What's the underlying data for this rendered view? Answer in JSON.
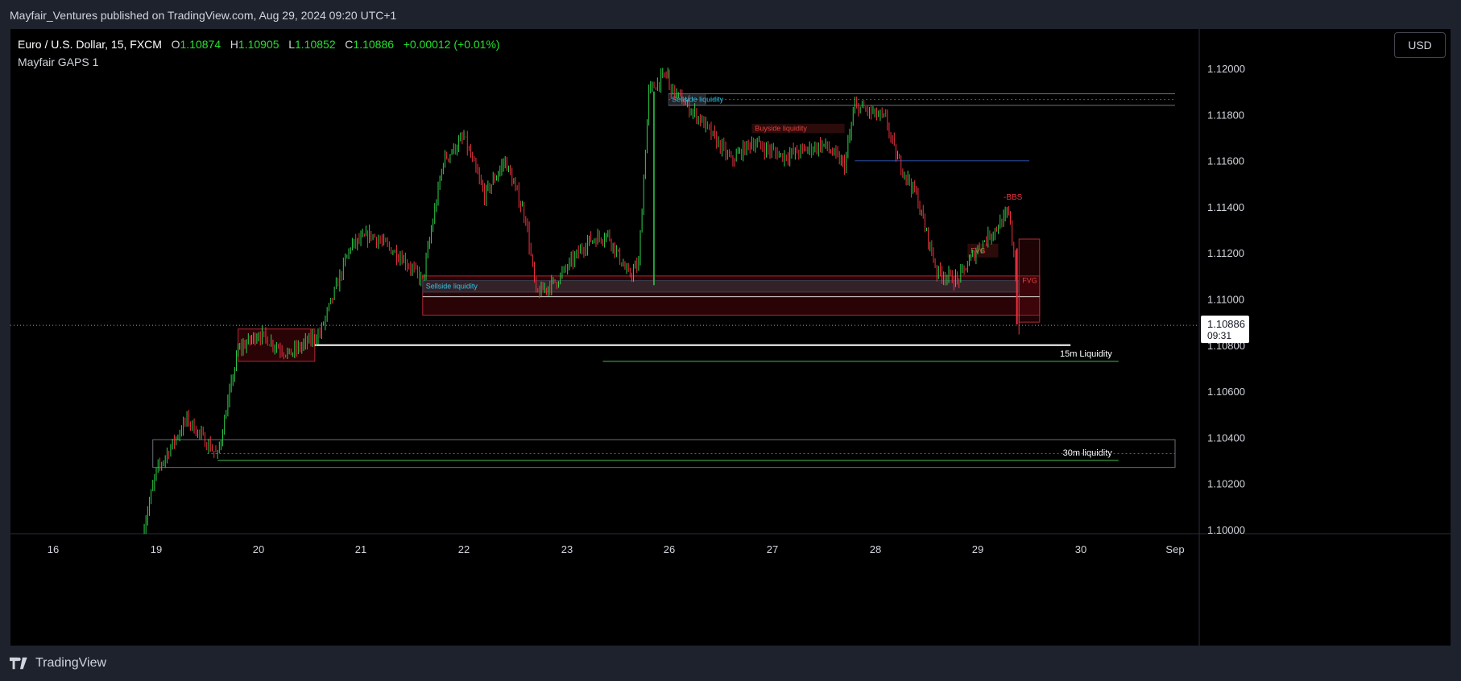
{
  "header": {
    "publisher_line": "Mayfair_Ventures published on TradingView.com, Aug 29, 2024 09:20 UTC+1"
  },
  "legend": {
    "symbol": "Euro / U.S. Dollar, 15, FXCM",
    "o_label": "O",
    "o_value": "1.10874",
    "h_label": "H",
    "h_value": "1.10905",
    "l_label": "L",
    "l_value": "1.10852",
    "c_label": "C",
    "c_value": "1.10886",
    "change": "+0.00012 (+0.01%)",
    "indicator": "Mayfair GAPS 1"
  },
  "currency_button": "USD",
  "footer": {
    "brand": "TradingView"
  },
  "colors": {
    "bull": "#26a69a",
    "bull_bright": "#2fd04a",
    "bear": "#ef5350",
    "zone_fill": "#2a0a0d",
    "zone_border": "#b22833",
    "sellside_text": "#2ec4e6",
    "buyside_text": "#e0443c",
    "liquidity_line": "#2e7d32",
    "white_line": "#ffffff"
  },
  "chart_data": {
    "type": "candlestick",
    "symbol": "EURUSD",
    "timeframe": "15",
    "ylim": [
      1.0995,
      1.121
    ],
    "y_ticks": [
      "1.12000",
      "1.11800",
      "1.11600",
      "1.11400",
      "1.11200",
      "1.11000",
      "1.10800",
      "1.10600",
      "1.10400",
      "1.10200",
      "1.10000"
    ],
    "x_ticks": [
      "16",
      "19",
      "20",
      "21",
      "22",
      "23",
      "26",
      "27",
      "28",
      "29",
      "30",
      "Sep"
    ],
    "last_price": "1.10886",
    "countdown": "09:31",
    "anchors": [
      {
        "day": "18.6",
        "price": 1.0999
      },
      {
        "day": "19.0",
        "price": 1.1025
      },
      {
        "day": "19.3",
        "price": 1.1048
      },
      {
        "day": "19.6",
        "price": 1.1032
      },
      {
        "day": "19.8",
        "price": 1.1078
      },
      {
        "day": "20.0",
        "price": 1.1085
      },
      {
        "day": "20.3",
        "price": 1.1076
      },
      {
        "day": "20.6",
        "price": 1.1085
      },
      {
        "day": "20.9",
        "price": 1.1123
      },
      {
        "day": "21.1",
        "price": 1.1128
      },
      {
        "day": "21.4",
        "price": 1.1118
      },
      {
        "day": "21.6",
        "price": 1.1108
      },
      {
        "day": "21.8",
        "price": 1.116
      },
      {
        "day": "22.0",
        "price": 1.117
      },
      {
        "day": "22.2",
        "price": 1.1145
      },
      {
        "day": "22.4",
        "price": 1.116
      },
      {
        "day": "22.6",
        "price": 1.1135
      },
      {
        "day": "22.7",
        "price": 1.1102
      },
      {
        "day": "22.9",
        "price": 1.1108
      },
      {
        "day": "23.2",
        "price": 1.1125
      },
      {
        "day": "23.4",
        "price": 1.1128
      },
      {
        "day": "23.6",
        "price": 1.111
      },
      {
        "day": "23.7",
        "price": 1.1115
      },
      {
        "day": "23.8",
        "price": 1.119
      },
      {
        "day": "25.8",
        "price": 1.1198
      },
      {
        "day": "26.0",
        "price": 1.1192
      },
      {
        "day": "26.3",
        "price": 1.1178
      },
      {
        "day": "26.6",
        "price": 1.116
      },
      {
        "day": "26.8",
        "price": 1.1168
      },
      {
        "day": "27.1",
        "price": 1.1162
      },
      {
        "day": "27.5",
        "price": 1.1167
      },
      {
        "day": "27.7",
        "price": 1.1158
      },
      {
        "day": "27.8",
        "price": 1.1184
      },
      {
        "day": "28.1",
        "price": 1.1178
      },
      {
        "day": "28.2",
        "price": 1.1162
      },
      {
        "day": "28.4",
        "price": 1.1145
      },
      {
        "day": "28.6",
        "price": 1.1112
      },
      {
        "day": "28.8",
        "price": 1.1108
      },
      {
        "day": "29.0",
        "price": 1.1122
      },
      {
        "day": "29.2",
        "price": 1.1132
      },
      {
        "day": "29.3",
        "price": 1.1137
      },
      {
        "day": "29.35",
        "price": 1.112
      },
      {
        "day": "29.4",
        "price": 1.1089
      }
    ],
    "zones": [
      {
        "label": "",
        "from": "19.8",
        "to": "20.55",
        "low": 1.1073,
        "high": 1.1087,
        "style": "red"
      },
      {
        "label": "",
        "from": "21.6",
        "to": "29.6",
        "low": 1.1093,
        "high": 1.111,
        "style": "red"
      },
      {
        "label": "Sellside liquidity",
        "from": "21.6",
        "to": "29.4",
        "low": 1.1103,
        "high": 1.1108,
        "style": "dark"
      },
      {
        "label": "Sellside liquidity",
        "from": "25.9",
        "to": "26.35",
        "low": 1.1184,
        "high": 1.1189,
        "style": "dark"
      },
      {
        "label": "Buyside liquidity",
        "from": "26.8",
        "to": "27.7",
        "low": 1.1172,
        "high": 1.1176,
        "style": "darkred"
      },
      {
        "label": "FVG",
        "from": "28.9",
        "to": "29.2",
        "low": 1.1118,
        "high": 1.1124,
        "style": "darkred"
      },
      {
        "label": "FVG",
        "from": "29.4",
        "to": "29.6",
        "low": 1.109,
        "high": 1.1126,
        "style": "redline"
      },
      {
        "label": "",
        "from": "18.9",
        "to": "31.0",
        "low": 1.1027,
        "high": 1.1039,
        "style": "grey"
      }
    ],
    "lines": [
      {
        "label": "",
        "from": "25.9",
        "to": "31.0",
        "price": 1.1189,
        "style": "grey"
      },
      {
        "label": "",
        "from": "25.9",
        "to": "31.0",
        "price": 1.1184,
        "style": "grey"
      },
      {
        "label": "",
        "from": "25.9",
        "to": "31.0",
        "price": 1.11865,
        "style": "reddot"
      },
      {
        "label": "",
        "from": "27.8",
        "to": "29.5",
        "price": 1.116,
        "style": "navy"
      },
      {
        "label": "",
        "from": "21.6",
        "to": "29.6",
        "price": 1.1101,
        "style": "white_thin"
      },
      {
        "label": "",
        "from": "20.55",
        "to": "29.9",
        "price": 1.108,
        "style": "white"
      },
      {
        "label": "15m Liquidity",
        "from": "23.35",
        "to": "30.4",
        "price": 1.1073,
        "style": "green"
      },
      {
        "label": "30m liquidity",
        "from": "19.6",
        "to": "30.4",
        "price": 1.103,
        "style": "green"
      },
      {
        "label": "",
        "from": "19.5",
        "to": "31.0",
        "price": 1.1033,
        "style": "reddot"
      }
    ],
    "annotations": [
      {
        "text": "-BBS",
        "day": "29.25",
        "price": 1.1141
      }
    ]
  }
}
